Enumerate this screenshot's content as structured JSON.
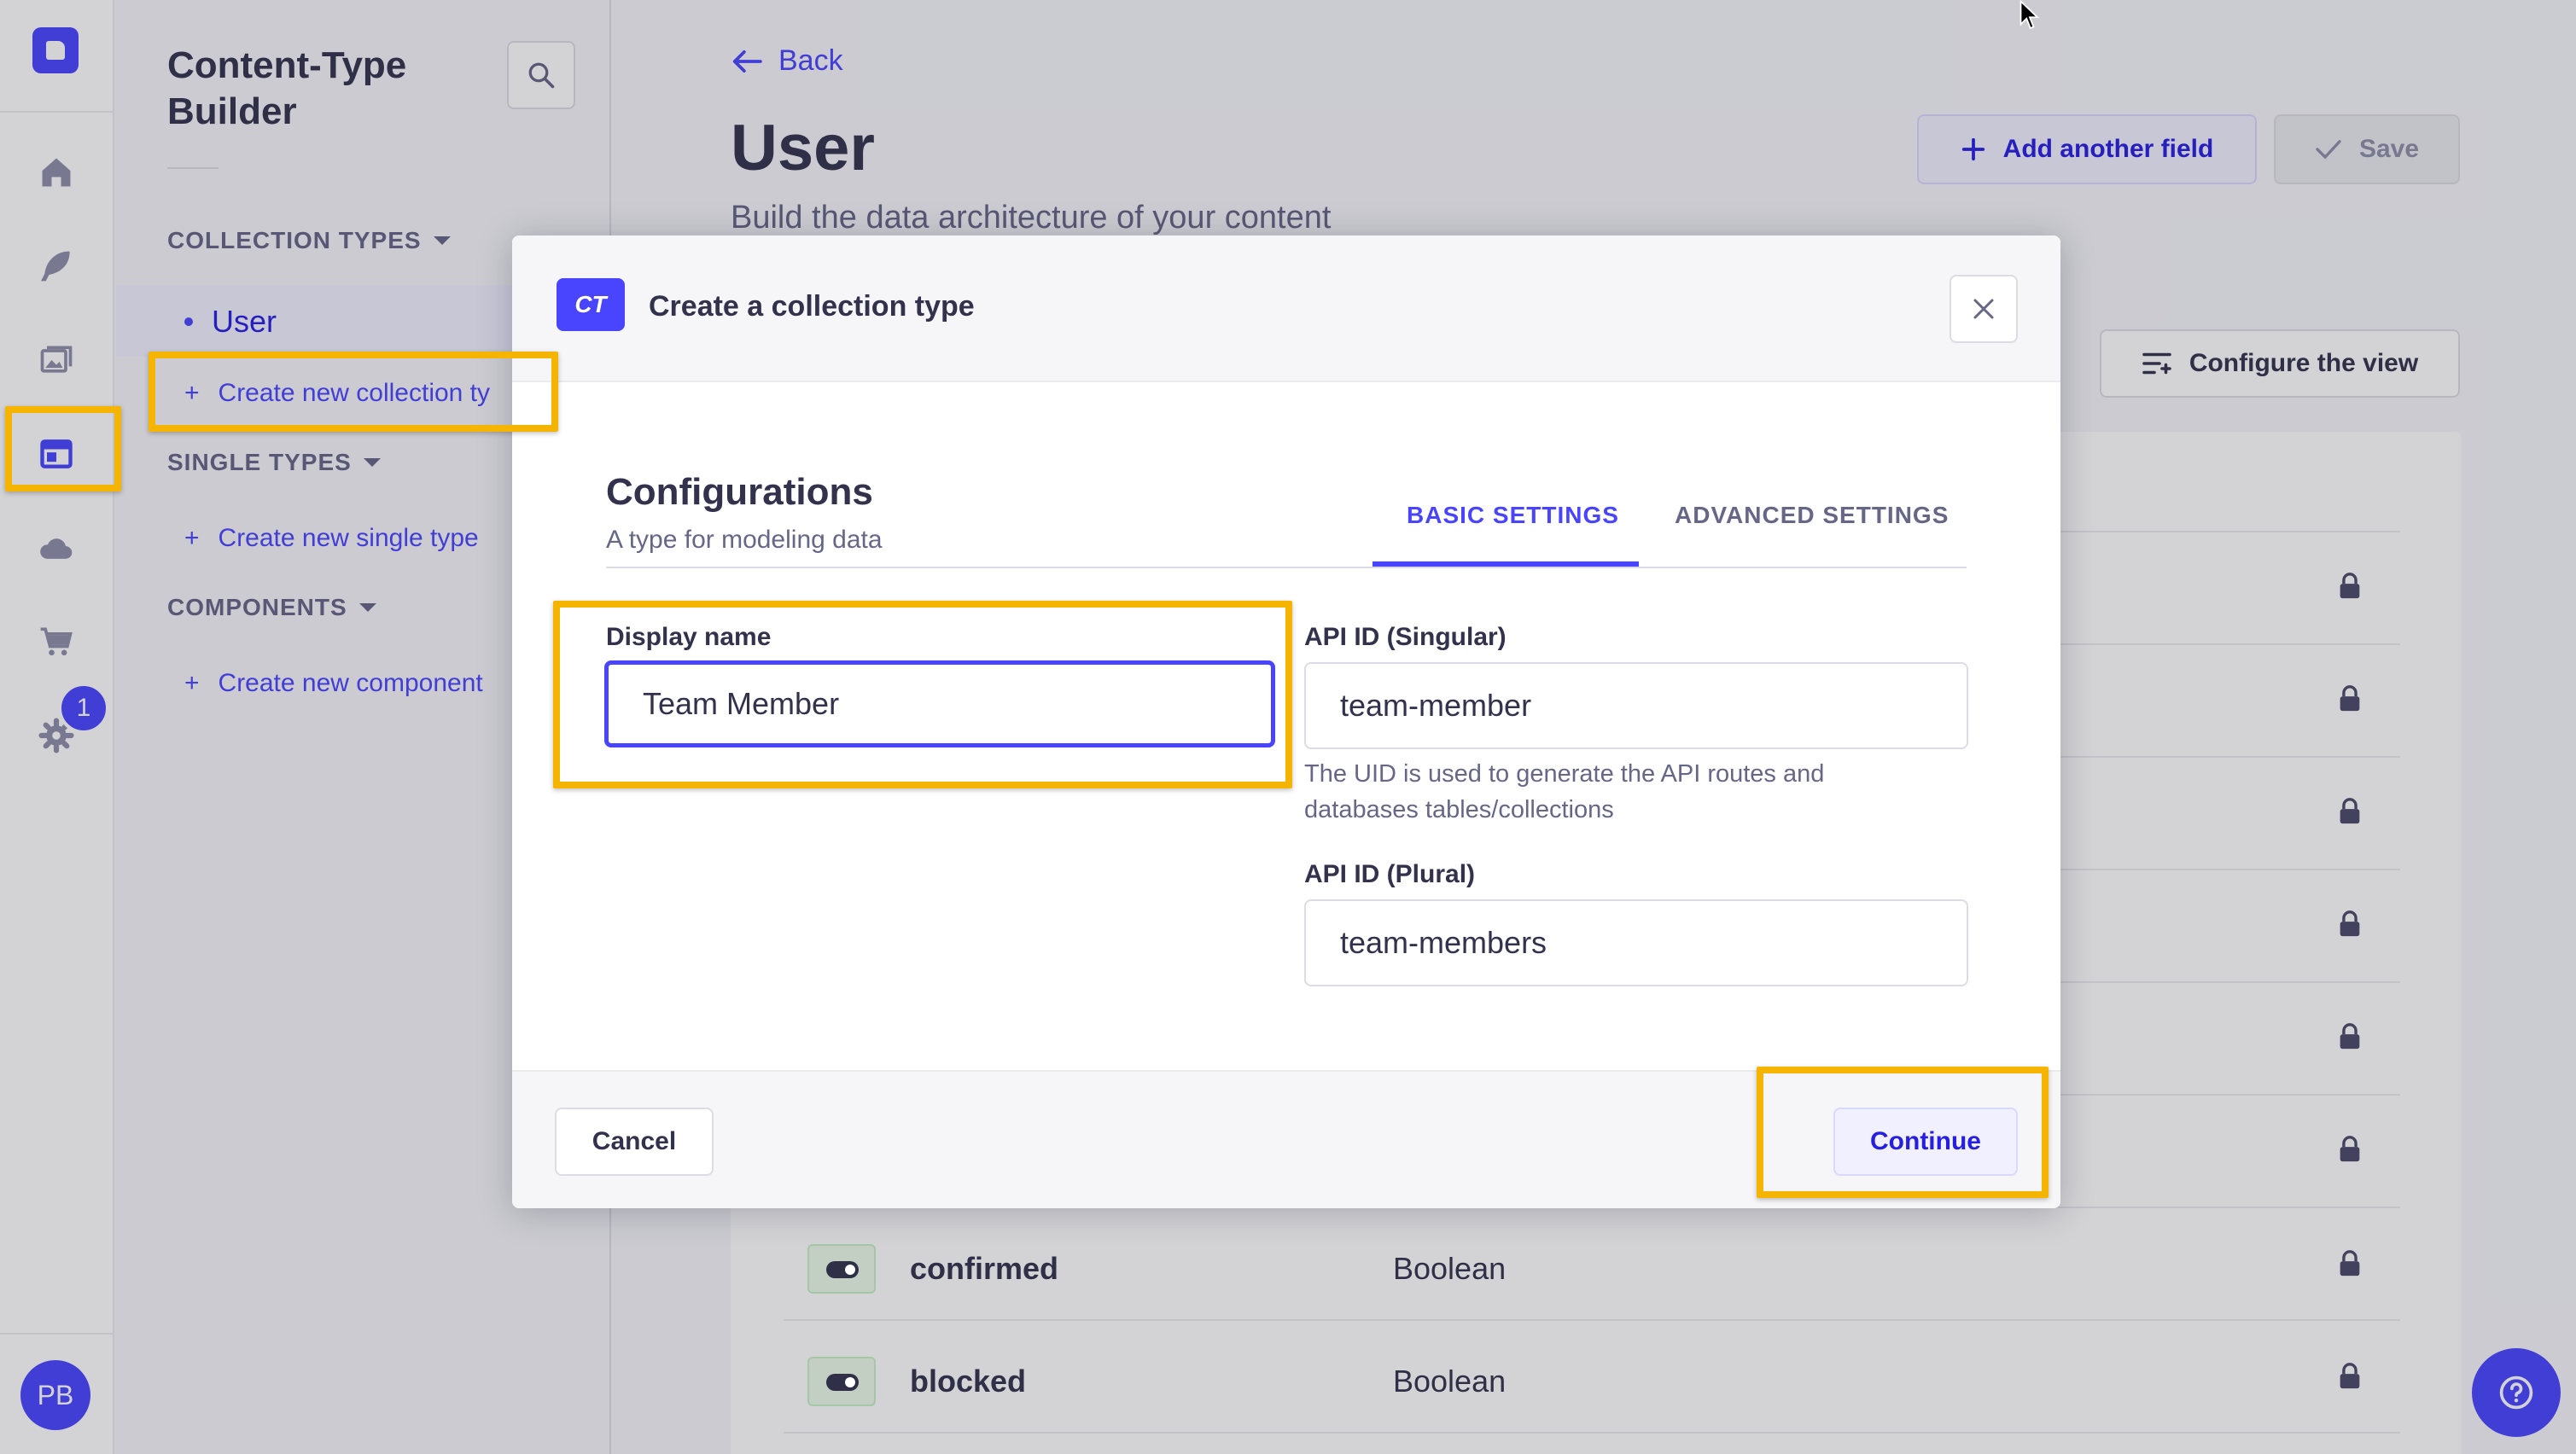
{
  "subnav": {
    "title": "Content-Type Builder",
    "collection_types_label": "COLLECTION TYPES",
    "collection_items": [
      "User"
    ],
    "create_collection_label": "Create new collection ty",
    "single_types_label": "SINGLE TYPES",
    "create_single_label": "Create new single type",
    "components_label": "COMPONENTS",
    "create_component_label": "Create new component"
  },
  "leftnav": {
    "icons": [
      "home-icon",
      "feather-icon",
      "media-icon",
      "layout-icon",
      "cloud-icon",
      "cart-icon",
      "settings-icon"
    ],
    "settings_badge": "1",
    "avatar_initials": "PB"
  },
  "header": {
    "back_label": "Back",
    "title": "User",
    "subtitle": "Build the data architecture of your content",
    "add_field_label": "Add another field",
    "save_label": "Save",
    "configure_view_label": "Configure the view"
  },
  "fields": [
    {
      "name": "confirmed",
      "type": "Boolean"
    },
    {
      "name": "blocked",
      "type": "Boolean"
    }
  ],
  "modal": {
    "badge": "CT",
    "title": "Create a collection type",
    "section_title": "Configurations",
    "section_subtitle": "A type for modeling data",
    "tabs": [
      "BASIC SETTINGS",
      "ADVANCED SETTINGS"
    ],
    "active_tab": "BASIC SETTINGS",
    "display_name_label": "Display name",
    "display_name_value": "Team Member",
    "api_singular_label": "API ID (Singular)",
    "api_singular_value": "team-member",
    "uid_hint": "The UID is used to generate the API routes and databases tables/collections",
    "api_plural_label": "API ID (Plural)",
    "api_plural_value": "team-members",
    "cancel_label": "Cancel",
    "continue_label": "Continue"
  },
  "colors": {
    "accent": "#4945ff",
    "highlight": "#f5b400"
  }
}
